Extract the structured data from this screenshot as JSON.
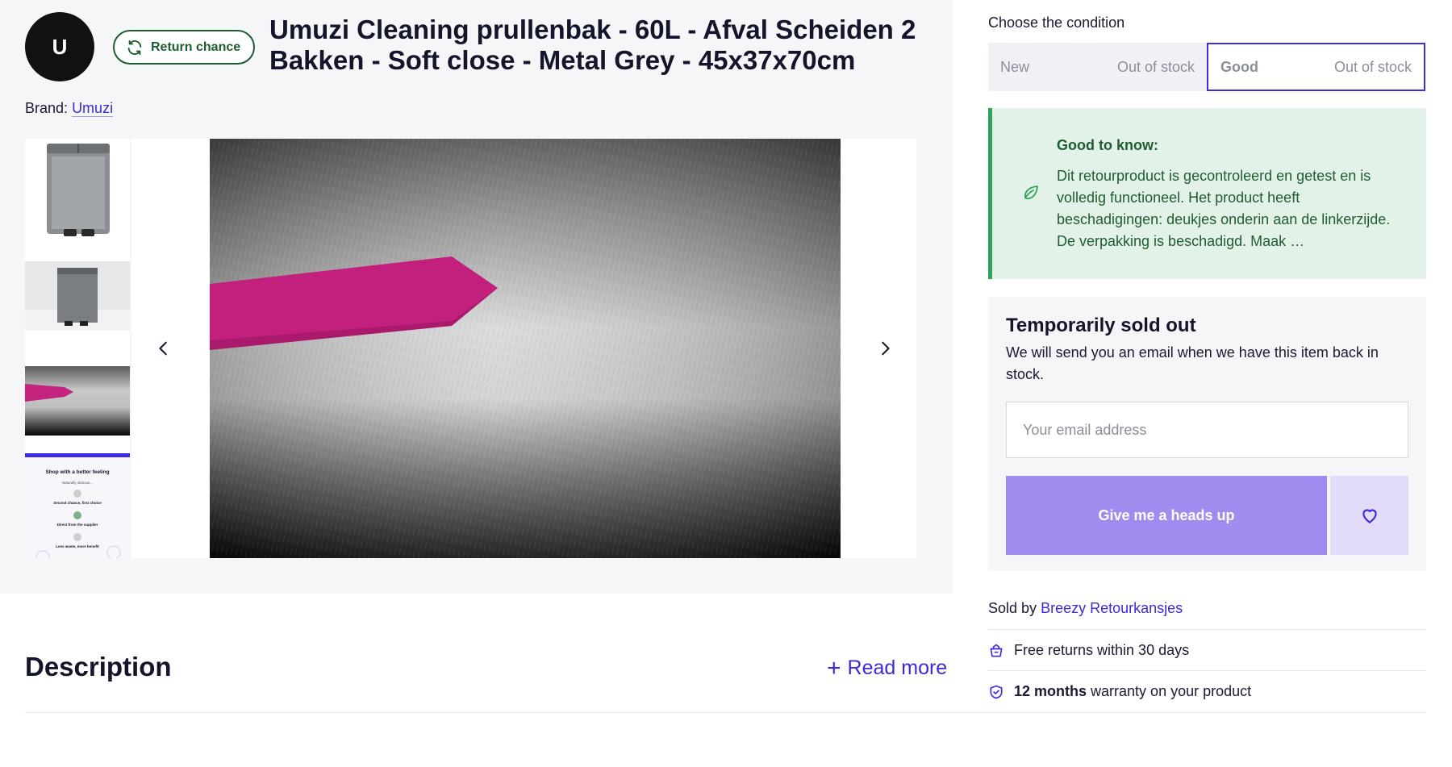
{
  "header": {
    "logo_letter": "U",
    "badge_label": "Return chance",
    "title": "Umuzi Cleaning prullenbak - 60L - Afval Scheiden 2 Bakken - Soft close - Metal Grey - 45x37x70cm"
  },
  "brand": {
    "prefix": "Brand:",
    "name": "Umuzi"
  },
  "gallery": {
    "selected_index": 2,
    "promo_thumb": {
      "heading": "Shop with a better feeling",
      "sub": "Naturally obvious...",
      "items": [
        "Second chance, first choice",
        "Direct from the supplier",
        "Less waste, more benefit"
      ]
    }
  },
  "description": {
    "heading": "Description",
    "read_more": "Read more"
  },
  "condition": {
    "label": "Choose the condition",
    "options": [
      {
        "name": "New",
        "status": "Out of stock",
        "selected": false
      },
      {
        "name": "Good",
        "status": "Out of stock",
        "selected": true
      }
    ]
  },
  "info": {
    "title": "Good to know:",
    "text": "Dit retourproduct is gecontroleerd en getest en is volledig functioneel. Het product heeft beschadigingen: deukjes onderin aan de linkerzijde. De verpakking is beschadigd. Maak …"
  },
  "sold_out": {
    "title": "Temporarily sold out",
    "text": "We will send you an email when we have this item back in stock.",
    "email_placeholder": "Your email address",
    "button_label": "Give me a heads up"
  },
  "seller": {
    "prefix": "Sold by",
    "name": "Breezy Retourkansjes"
  },
  "features": {
    "returns": "Free returns within 30 days",
    "warranty_bold": "12 months",
    "warranty_rest": " warranty on your product"
  },
  "colors": {
    "accent": "#3d2be0",
    "green": "#1f5c32",
    "button": "#a08bef"
  }
}
